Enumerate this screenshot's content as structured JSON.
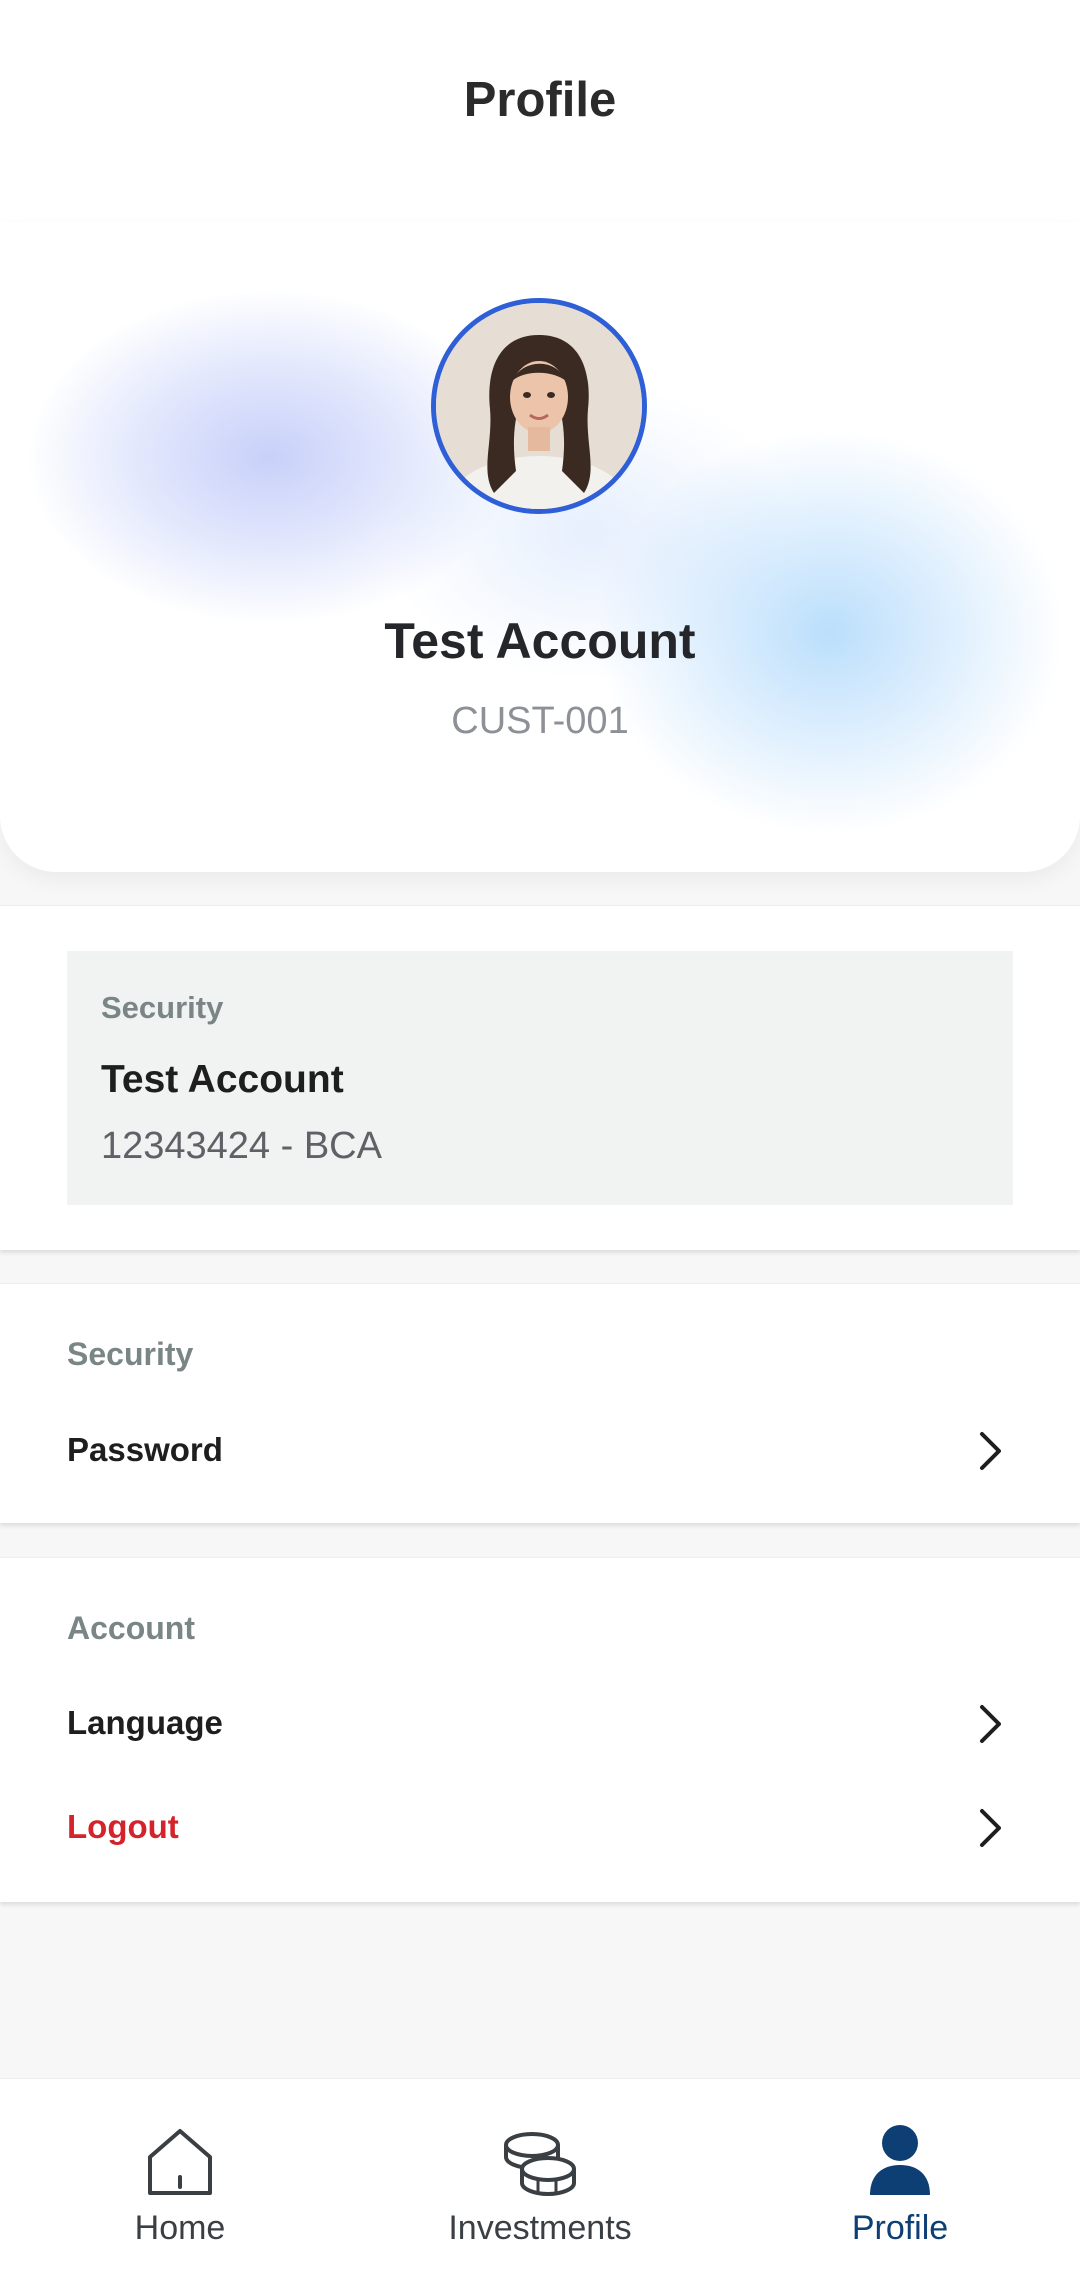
{
  "header": {
    "title": "Profile"
  },
  "profile": {
    "name": "Test Account",
    "customer_id": "CUST-001"
  },
  "bank": {
    "label": "Security",
    "account_name": "Test Account",
    "account_number": "12343424 - BCA"
  },
  "security_section": {
    "label": "Security",
    "items": [
      {
        "label": "Password"
      }
    ]
  },
  "account_section": {
    "label": "Account",
    "items": [
      {
        "label": "Language"
      },
      {
        "label": "Logout"
      }
    ]
  },
  "bottom_nav": {
    "items": [
      {
        "label": "Home",
        "icon": "home-icon",
        "active": false
      },
      {
        "label": "Investments",
        "icon": "coins-icon",
        "active": false
      },
      {
        "label": "Profile",
        "icon": "person-icon",
        "active": true
      }
    ]
  },
  "colors": {
    "accent": "#0d3f74",
    "avatar_ring": "#2f5fd6",
    "danger": "#d4232b"
  }
}
